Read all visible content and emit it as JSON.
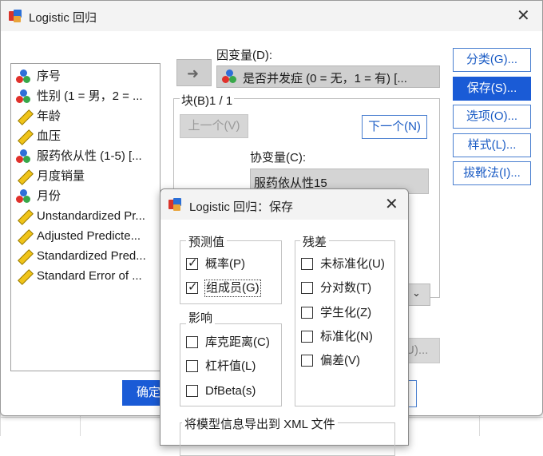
{
  "main_dialog": {
    "title": "Logistic 回归",
    "close": "✕",
    "variables": [
      {
        "label": "序号",
        "type": "nominal"
      },
      {
        "label": "性别 (1 = 男，2 = ...",
        "type": "nominal"
      },
      {
        "label": "年龄",
        "type": "scale"
      },
      {
        "label": "血压",
        "type": "scale"
      },
      {
        "label": "服药依从性 (1-5) [...",
        "type": "nominal"
      },
      {
        "label": "月度销量",
        "type": "scale"
      },
      {
        "label": "月份",
        "type": "nominal"
      },
      {
        "label": "Unstandardized Pr...",
        "type": "scale"
      },
      {
        "label": "Adjusted Predicte...",
        "type": "scale"
      },
      {
        "label": "Standardized Pred...",
        "type": "scale"
      },
      {
        "label": "Standard Error of ...",
        "type": "scale"
      }
    ],
    "dependent_label": "因变量(D):",
    "dependent_value": "是否并发症 (0 = 无，1 = 有) [...",
    "block_label": "块(B)1 / 1",
    "prev_button": "上一个(V)",
    "next_button": "下一个(N)",
    "covariates_label": "协变量(C):",
    "covariates": [
      "服药依从性15"
    ],
    "method_arrow": "⌄",
    "hidden_button": "U)...",
    "ok_button": "确定",
    "right_buttons": [
      "分类(G)...",
      "保存(S)...",
      "选项(O)...",
      "样式(L)...",
      "拔靴法(I)..."
    ]
  },
  "save_dialog": {
    "title": "Logistic 回归：保存",
    "close": "✕",
    "predicted_group": "预测值",
    "predicted": [
      {
        "label": "概率(P)",
        "checked": true
      },
      {
        "label": "组成员(G)",
        "checked": true
      }
    ],
    "influence_group": "影响",
    "influence": [
      {
        "label": "库克距离(C)",
        "checked": false
      },
      {
        "label": "杠杆值(L)",
        "checked": false
      },
      {
        "label": "DfBeta(s)",
        "checked": false
      }
    ],
    "residuals_group": "残差",
    "residuals": [
      {
        "label": "未标准化(U)",
        "checked": false
      },
      {
        "label": "分对数(T)",
        "checked": false
      },
      {
        "label": "学生化(Z)",
        "checked": false
      },
      {
        "label": "标准化(N)",
        "checked": false
      },
      {
        "label": "偏差(V)",
        "checked": false
      }
    ],
    "xml_group": "将模型信息导出到 XML 文件"
  },
  "colors": {
    "accent": "#1a5bd6",
    "disabled": "#d6d6d6"
  }
}
